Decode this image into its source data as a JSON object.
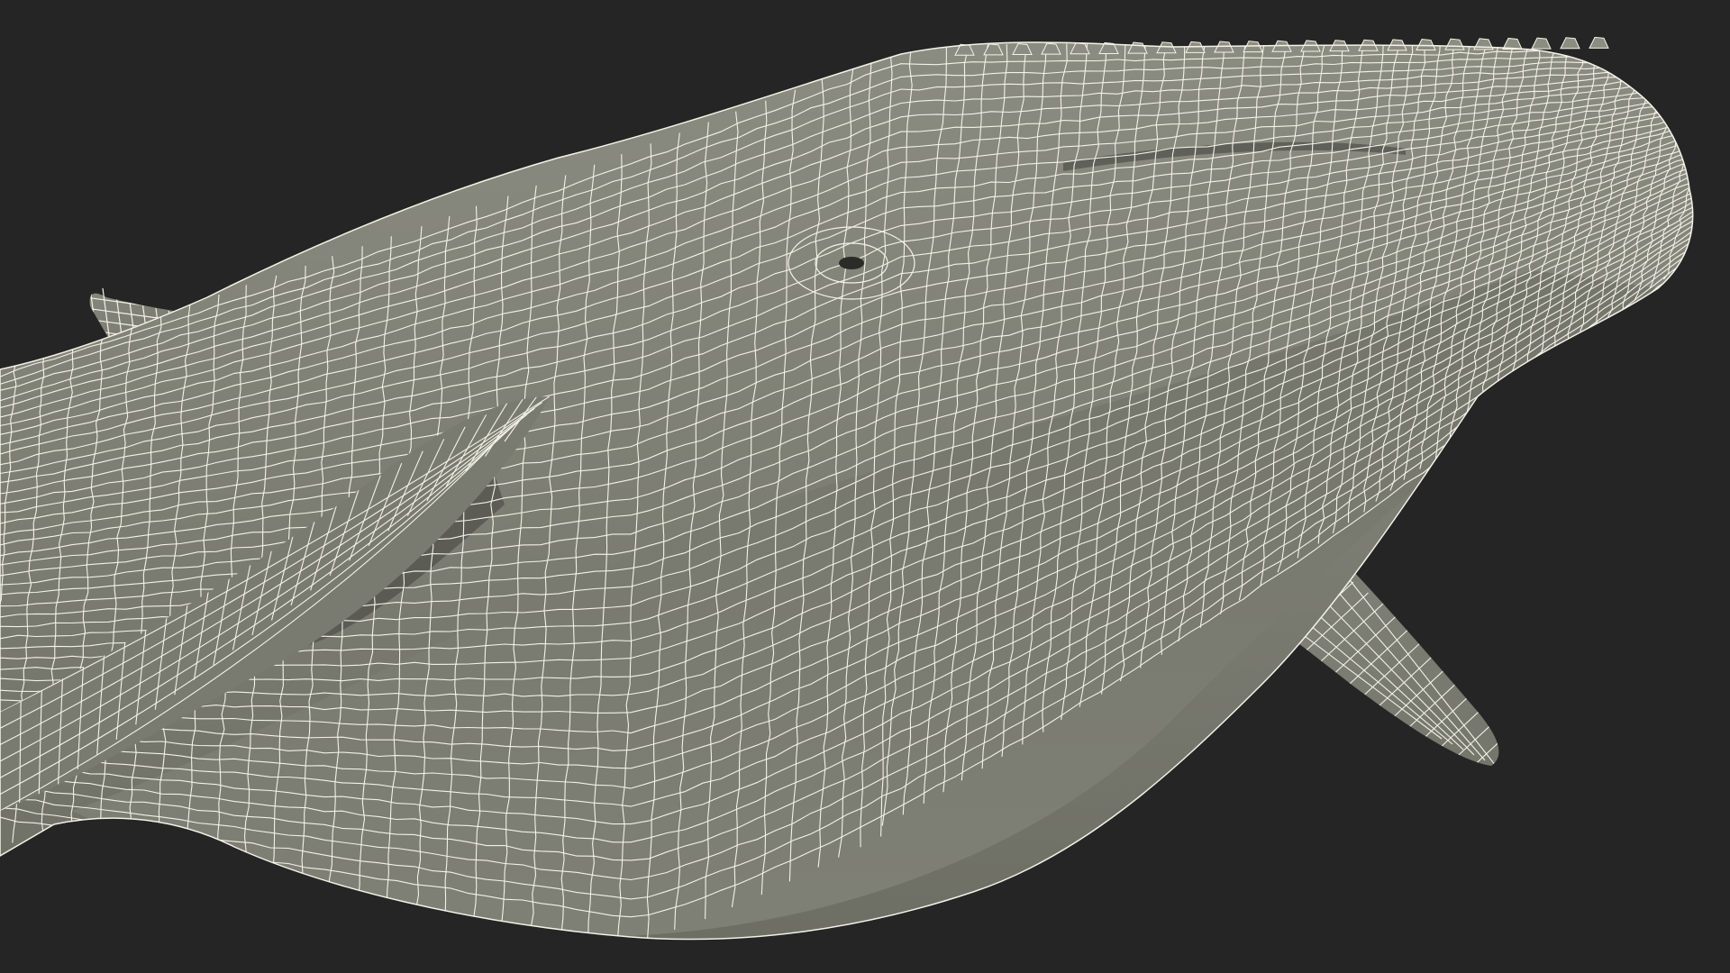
{
  "scene": {
    "subject": "humpback-whale",
    "render_style": "wireframe",
    "colors": {
      "background": "#252525",
      "surface": "#7d7e73",
      "surface_light": "#8e8f84",
      "surface_shadow": "#54554d",
      "wire": "#f3f2e6"
    }
  }
}
